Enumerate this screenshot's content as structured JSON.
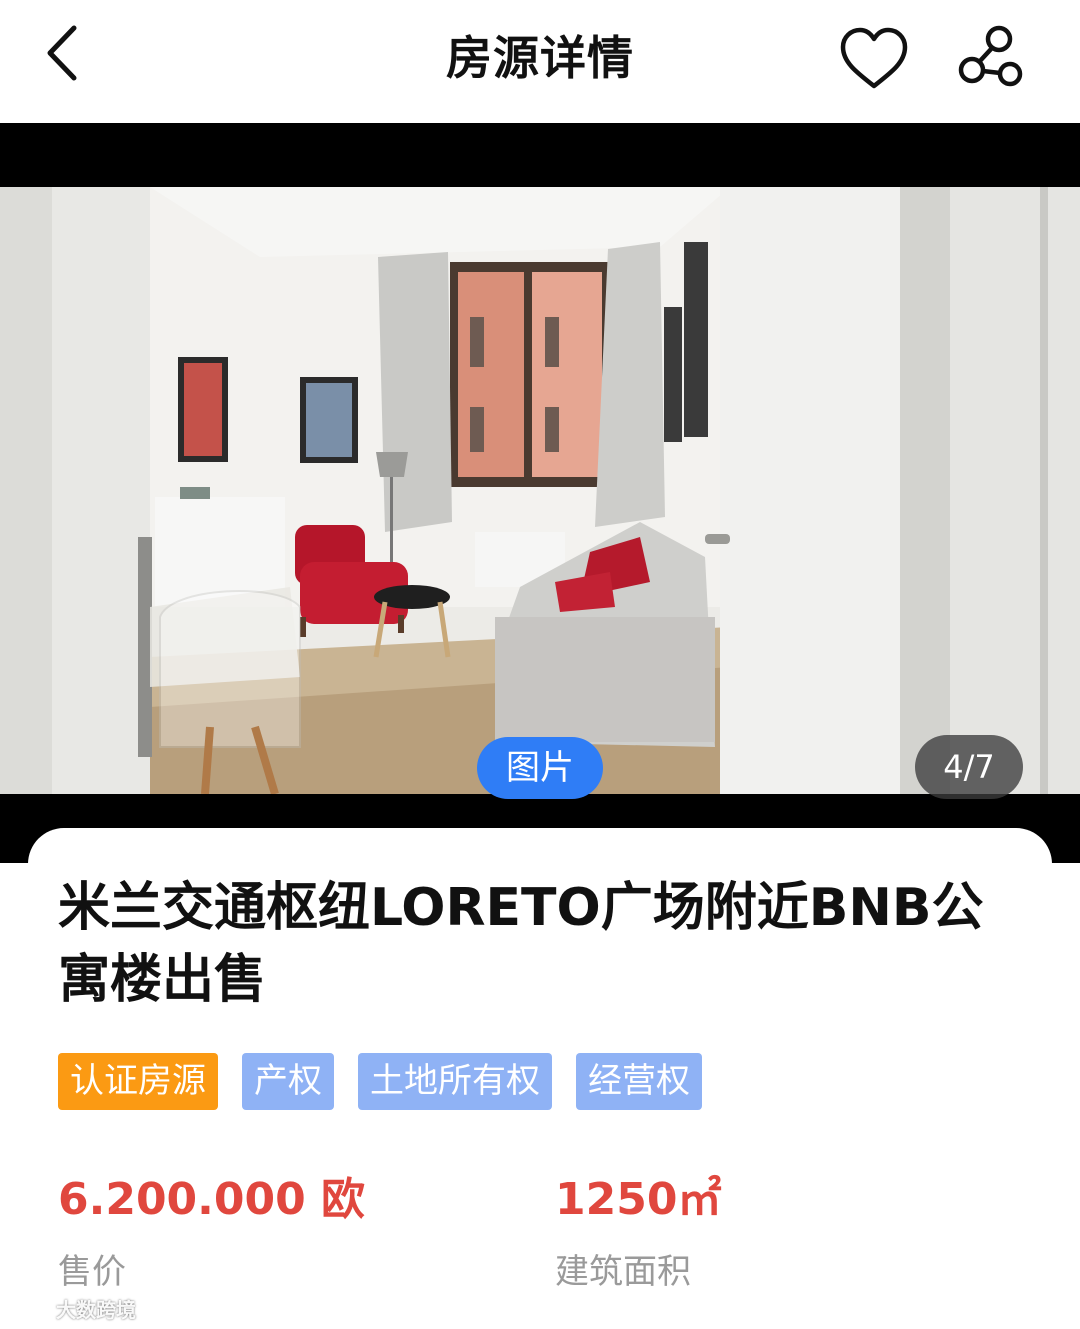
{
  "header": {
    "title": "房源详情"
  },
  "gallery": {
    "media_label": "图片",
    "counter": "4/7"
  },
  "listing": {
    "title": "米兰交通枢纽LORETO广场附近BNB公寓楼出售",
    "tags": [
      {
        "label": "认证房源",
        "style": "orange"
      },
      {
        "label": "产权",
        "style": "blue"
      },
      {
        "label": "土地所有权",
        "style": "blue"
      },
      {
        "label": "经营权",
        "style": "blue"
      }
    ],
    "price": {
      "value": "6.200.000 欧",
      "label": "售价"
    },
    "area": {
      "value": "1250㎡",
      "label": "建筑面积"
    }
  },
  "watermark": {
    "text": "大数跨境"
  },
  "colors": {
    "accent_blue": "#2f7df6",
    "tag_orange": "#fb9a13",
    "tag_blue": "#8fb2f5",
    "price_red": "#e0473e",
    "label_gray": "#9a9a9a"
  },
  "icons": [
    "back-arrow-icon",
    "heart-icon",
    "share-icon"
  ]
}
